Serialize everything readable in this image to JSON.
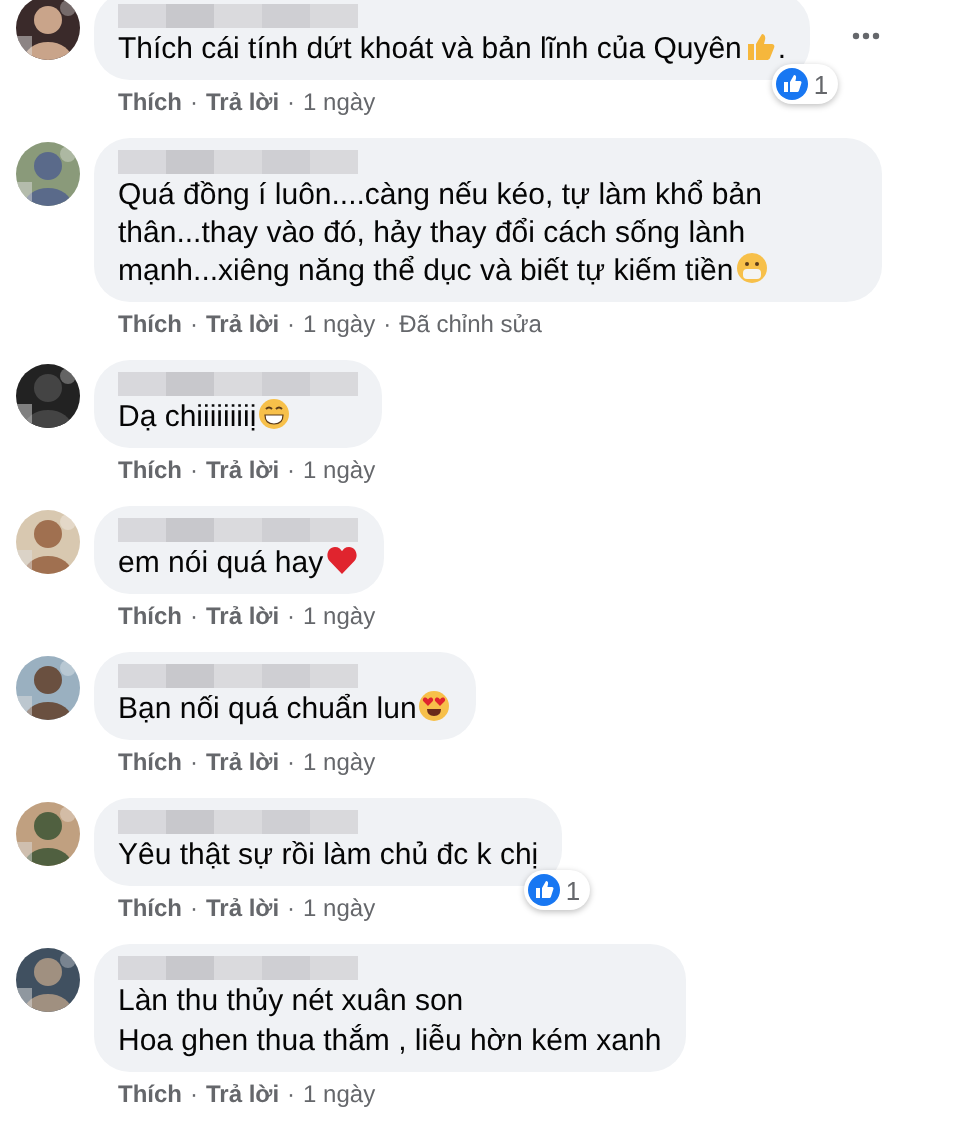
{
  "separator": "·",
  "comments": [
    {
      "text": "Thích cái tính dứt khoát và bản lĩnh của Quyên",
      "emoji": {
        "kind": "thumbs-up"
      },
      "trailing_text": ".",
      "has_menu": true,
      "reaction": {
        "count": "1"
      },
      "meta": {
        "like": "Thích",
        "reply": "Trả lời",
        "time": "1 ngày"
      }
    },
    {
      "text": "Quá đồng í luôn....càng nếu kéo, tự làm khổ bản thân...thay vào đó, hảy thay đổi cách sống lành mạnh...xiêng năng thể dục và biết tự kiếm tiền",
      "emoji": {
        "kind": "mask-face"
      },
      "has_menu": false,
      "meta": {
        "like": "Thích",
        "reply": "Trả lời",
        "time": "1 ngày",
        "edited": "Đã chỉnh sửa"
      }
    },
    {
      "text": "Dạ chiiiiiiiiị",
      "emoji": {
        "kind": "grin-face"
      },
      "has_menu": false,
      "meta": {
        "like": "Thích",
        "reply": "Trả lời",
        "time": "1 ngày"
      }
    },
    {
      "text": "em nói quá hay",
      "emoji": {
        "kind": "heart"
      },
      "has_menu": false,
      "meta": {
        "like": "Thích",
        "reply": "Trả lời",
        "time": "1 ngày"
      }
    },
    {
      "text": "Bạn nối quá chuẩn lun",
      "emoji": {
        "kind": "heart-eyes-face"
      },
      "has_menu": false,
      "meta": {
        "like": "Thích",
        "reply": "Trả lời",
        "time": "1 ngày"
      }
    },
    {
      "text": "Yêu thật sự rồi làm chủ đc k chị",
      "has_menu": false,
      "reaction": {
        "count": "1"
      },
      "meta": {
        "like": "Thích",
        "reply": "Trả lời",
        "time": "1 ngày"
      }
    },
    {
      "lines": [
        "Làn thu thủy nét xuân son",
        "Hoa ghen thua thắm , liễu hờn kém xanh"
      ],
      "has_menu": false,
      "meta": {
        "like": "Thích",
        "reply": "Trả lời",
        "time": "1 ngày"
      }
    }
  ]
}
